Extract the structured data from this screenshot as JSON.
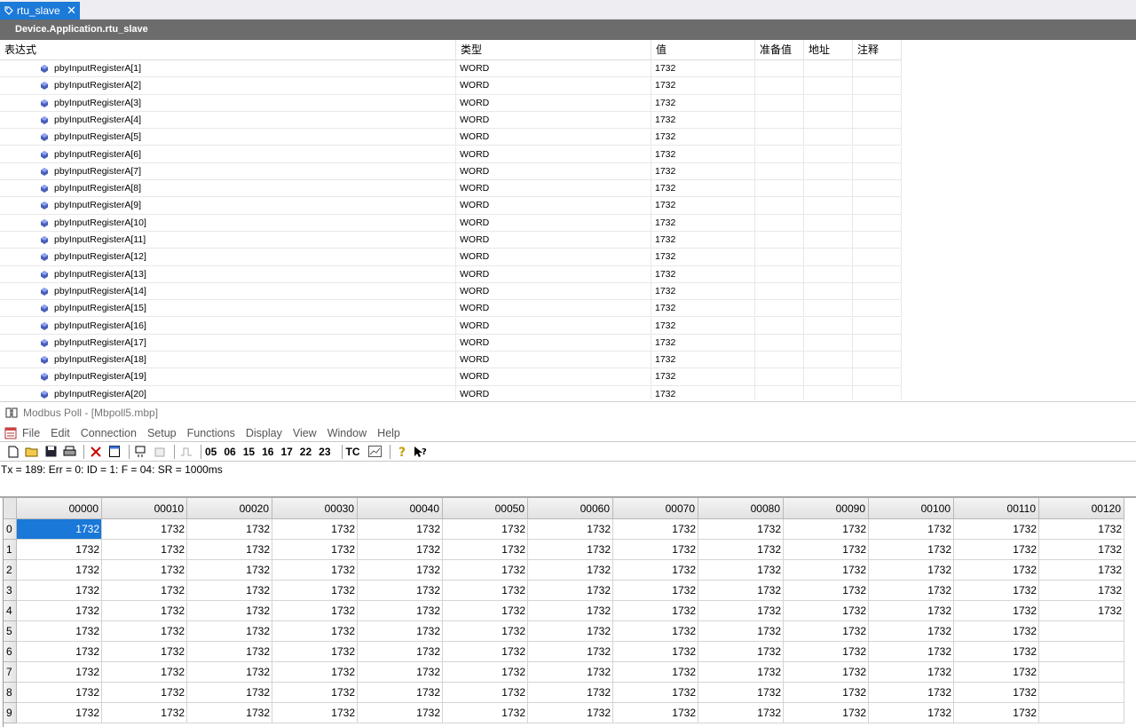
{
  "tab": {
    "label": "rtu_slave",
    "close": "✕"
  },
  "device_path": "Device.Application.rtu_slave",
  "watch": {
    "headers": {
      "expr": "表达式",
      "type": "类型",
      "value": "值",
      "prepared": "准备值",
      "address": "地址",
      "comment": "注释"
    },
    "rows": [
      {
        "name": "pbyInputRegisterA[1]",
        "type": "WORD",
        "value": "1732"
      },
      {
        "name": "pbyInputRegisterA[2]",
        "type": "WORD",
        "value": "1732"
      },
      {
        "name": "pbyInputRegisterA[3]",
        "type": "WORD",
        "value": "1732"
      },
      {
        "name": "pbyInputRegisterA[4]",
        "type": "WORD",
        "value": "1732"
      },
      {
        "name": "pbyInputRegisterA[5]",
        "type": "WORD",
        "value": "1732"
      },
      {
        "name": "pbyInputRegisterA[6]",
        "type": "WORD",
        "value": "1732"
      },
      {
        "name": "pbyInputRegisterA[7]",
        "type": "WORD",
        "value": "1732"
      },
      {
        "name": "pbyInputRegisterA[8]",
        "type": "WORD",
        "value": "1732"
      },
      {
        "name": "pbyInputRegisterA[9]",
        "type": "WORD",
        "value": "1732"
      },
      {
        "name": "pbyInputRegisterA[10]",
        "type": "WORD",
        "value": "1732"
      },
      {
        "name": "pbyInputRegisterA[11]",
        "type": "WORD",
        "value": "1732"
      },
      {
        "name": "pbyInputRegisterA[12]",
        "type": "WORD",
        "value": "1732"
      },
      {
        "name": "pbyInputRegisterA[13]",
        "type": "WORD",
        "value": "1732"
      },
      {
        "name": "pbyInputRegisterA[14]",
        "type": "WORD",
        "value": "1732"
      },
      {
        "name": "pbyInputRegisterA[15]",
        "type": "WORD",
        "value": "1732"
      },
      {
        "name": "pbyInputRegisterA[16]",
        "type": "WORD",
        "value": "1732"
      },
      {
        "name": "pbyInputRegisterA[17]",
        "type": "WORD",
        "value": "1732"
      },
      {
        "name": "pbyInputRegisterA[18]",
        "type": "WORD",
        "value": "1732"
      },
      {
        "name": "pbyInputRegisterA[19]",
        "type": "WORD",
        "value": "1732"
      },
      {
        "name": "pbyInputRegisterA[20]",
        "type": "WORD",
        "value": "1732"
      }
    ]
  },
  "modbus": {
    "title": "Modbus Poll - [Mbpoll5.mbp]",
    "menu": [
      "File",
      "Edit",
      "Connection",
      "Setup",
      "Functions",
      "Display",
      "View",
      "Window",
      "Help"
    ],
    "function_codes": [
      "05",
      "06",
      "15",
      "16",
      "17",
      "22",
      "23"
    ],
    "tc_label": "TC",
    "status": "Tx = 189: Err = 0: ID = 1: F = 04: SR = 1000ms",
    "columns": [
      "00000",
      "00010",
      "00020",
      "00030",
      "00040",
      "00050",
      "00060",
      "00070",
      "00080",
      "00090",
      "00100",
      "00110",
      "00120"
    ],
    "row_labels": [
      "0",
      "1",
      "2",
      "3",
      "4",
      "5",
      "6",
      "7",
      "8",
      "9"
    ],
    "rows": [
      [
        "1732",
        "1732",
        "1732",
        "1732",
        "1732",
        "1732",
        "1732",
        "1732",
        "1732",
        "1732",
        "1732",
        "1732",
        "1732"
      ],
      [
        "1732",
        "1732",
        "1732",
        "1732",
        "1732",
        "1732",
        "1732",
        "1732",
        "1732",
        "1732",
        "1732",
        "1732",
        "1732"
      ],
      [
        "1732",
        "1732",
        "1732",
        "1732",
        "1732",
        "1732",
        "1732",
        "1732",
        "1732",
        "1732",
        "1732",
        "1732",
        "1732"
      ],
      [
        "1732",
        "1732",
        "1732",
        "1732",
        "1732",
        "1732",
        "1732",
        "1732",
        "1732",
        "1732",
        "1732",
        "1732",
        "1732"
      ],
      [
        "1732",
        "1732",
        "1732",
        "1732",
        "1732",
        "1732",
        "1732",
        "1732",
        "1732",
        "1732",
        "1732",
        "1732",
        "1732"
      ],
      [
        "1732",
        "1732",
        "1732",
        "1732",
        "1732",
        "1732",
        "1732",
        "1732",
        "1732",
        "1732",
        "1732",
        "1732",
        ""
      ],
      [
        "1732",
        "1732",
        "1732",
        "1732",
        "1732",
        "1732",
        "1732",
        "1732",
        "1732",
        "1732",
        "1732",
        "1732",
        ""
      ],
      [
        "1732",
        "1732",
        "1732",
        "1732",
        "1732",
        "1732",
        "1732",
        "1732",
        "1732",
        "1732",
        "1732",
        "1732",
        ""
      ],
      [
        "1732",
        "1732",
        "1732",
        "1732",
        "1732",
        "1732",
        "1732",
        "1732",
        "1732",
        "1732",
        "1732",
        "1732",
        ""
      ],
      [
        "1732",
        "1732",
        "1732",
        "1732",
        "1732",
        "1732",
        "1732",
        "1732",
        "1732",
        "1732",
        "1732",
        "1732",
        ""
      ]
    ],
    "selected_cell": [
      0,
      0
    ]
  },
  "colors": {
    "accent": "#1c7ad8",
    "devbar": "#6c6c6c",
    "selection": "#1a78d8"
  }
}
